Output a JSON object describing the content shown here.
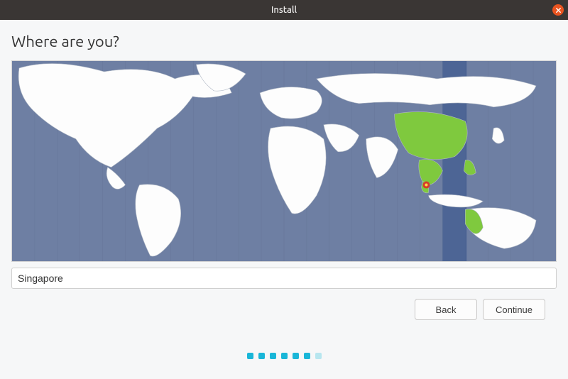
{
  "titlebar": {
    "title": "Install"
  },
  "heading": "Where are you?",
  "location": {
    "value": "Singapore"
  },
  "buttons": {
    "back": "Back",
    "continue": "Continue"
  },
  "progress": {
    "total": 7,
    "current": 6
  },
  "map": {
    "selected_region": "Singapore",
    "highlighted_timezone_band": "UTC+8",
    "pin": {
      "x_pct": 76.2,
      "y_pct": 61.5
    }
  },
  "icons": {
    "close": "close-icon"
  }
}
